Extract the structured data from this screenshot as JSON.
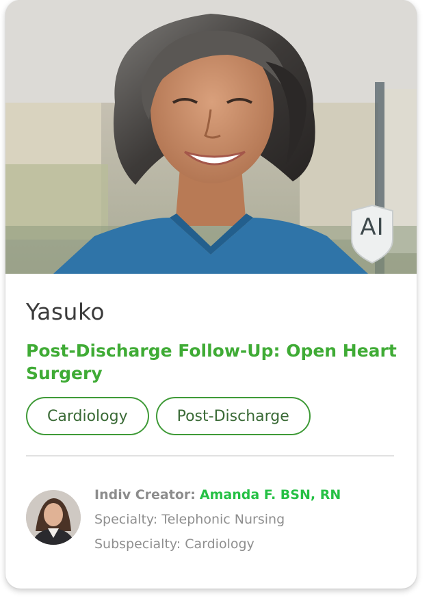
{
  "badge": {
    "text": "AI"
  },
  "card": {
    "name": "Yasuko",
    "title": "Post-Discharge Follow-Up: Open Heart Surgery",
    "tags": [
      "Cardiology",
      "Post-Discharge"
    ]
  },
  "creator": {
    "label": "Indiv Creator:",
    "name": "Amanda F. BSN, RN",
    "specialty": "Specialty: Telephonic Nursing",
    "subspecialty": "Subspecialty: Cardiology"
  },
  "colors": {
    "title_green": "#3fab35",
    "creator_name_green": "#25c044",
    "tag_border": "#3f9a37",
    "scrubs_blue": "#2f74a8"
  },
  "icons": {
    "badge": "ai-shield-icon"
  }
}
